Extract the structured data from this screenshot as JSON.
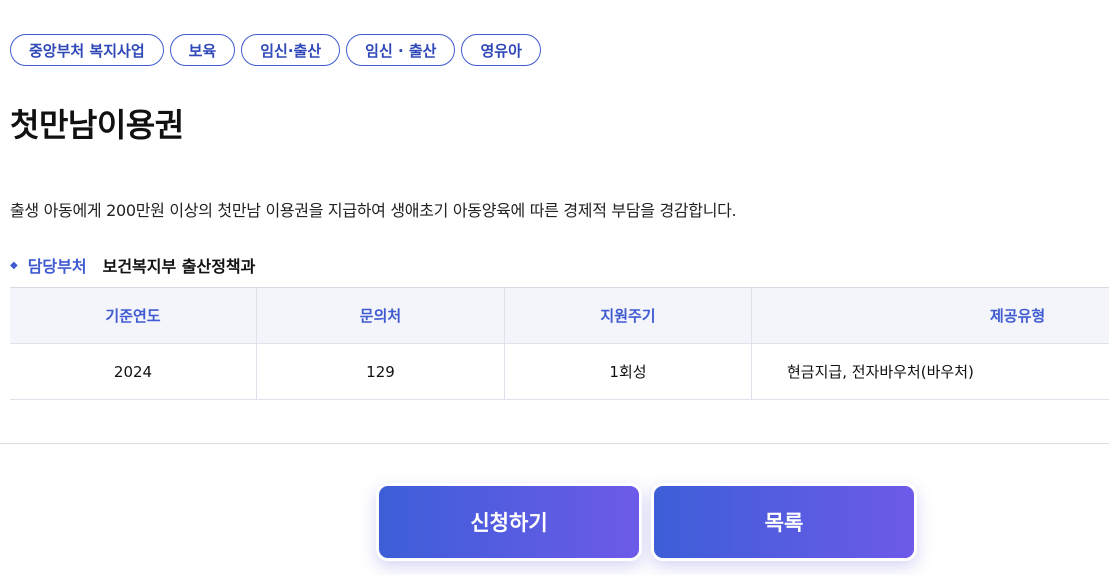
{
  "tags": [
    "중앙부처 복지사업",
    "보육",
    "임신·출산",
    "임신 · 출산",
    "영유아"
  ],
  "title": "첫만남이용권",
  "description": "출생 아동에게 200만원 이상의 첫만남 이용권을 지급하여 생애초기 아동양육에 따른 경제적 부담을 경감합니다.",
  "department": {
    "label": "담당부처",
    "value": "보건복지부 출산정책과"
  },
  "table": {
    "headers": [
      "기준연도",
      "문의처",
      "지원주기",
      "제공유형"
    ],
    "row": [
      "2024",
      "129",
      "1회성",
      "현금지급, 전자바우처(바우처)"
    ]
  },
  "buttons": {
    "apply": "신청하기",
    "list": "목록"
  }
}
